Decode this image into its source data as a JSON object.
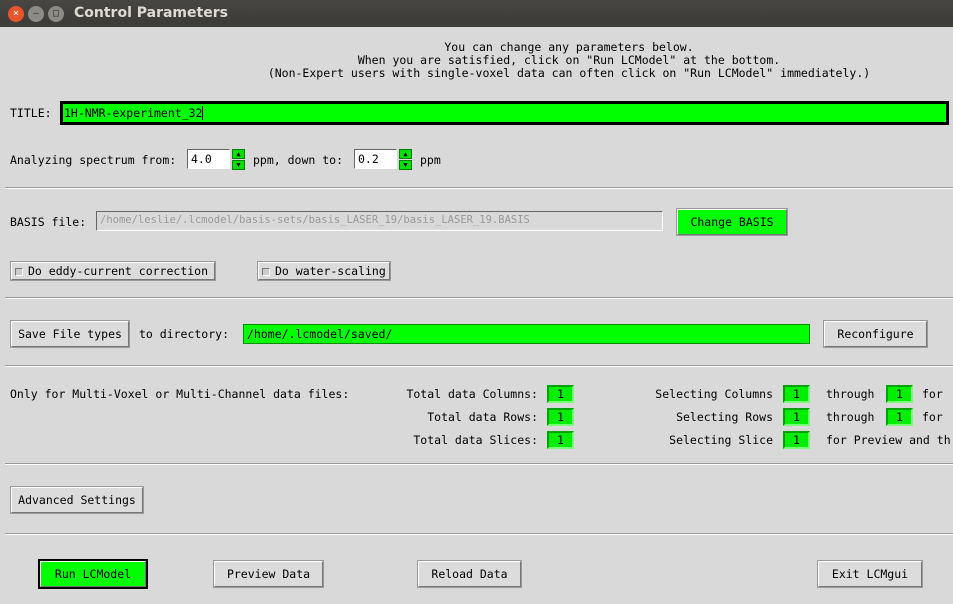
{
  "window": {
    "title": "Control Parameters",
    "close": "×",
    "minimize": "–",
    "maximize": "□"
  },
  "intro": [
    "You can change any parameters below.",
    "When you are satisfied, click on \"Run LCModel\" at the bottom.",
    "(Non-Expert users with single-voxel data can often click on \"Run LCModel\" immediately.)"
  ],
  "title_label": "TITLE:",
  "title_value": "1H-NMR-experiment_32",
  "range": {
    "label_from": "Analyzing spectrum from:",
    "from": "4.0",
    "unit1": "ppm, down to:",
    "to": "0.2",
    "unit2": "ppm",
    "up": "▲",
    "down": "▼"
  },
  "basis": {
    "label": "BASIS file:",
    "path": "/home/leslie/.lcmodel/basis-sets/basis_LASER_19/basis_LASER_19.BASIS",
    "change": "Change BASIS"
  },
  "options": {
    "eddy": "Do eddy-current correction",
    "water": "Do water-scaling"
  },
  "save": {
    "button": "Save File types",
    "label": "to directory:",
    "dir": "/home/.lcmodel/saved/",
    "reconfigure": "Reconfigure"
  },
  "multi": {
    "label": "Only for Multi-Voxel or Multi-Channel data files:",
    "total_columns_label": "Total data Columns:",
    "total_columns": "1",
    "total_rows_label": "Total data Rows:",
    "total_rows": "1",
    "total_slices_label": "Total data Slices:",
    "total_slices": "1",
    "sel_columns_label": "Selecting Columns",
    "sel_columns_from": "1",
    "sel_columns_to": "1",
    "sel_rows_label": "Selecting Rows",
    "sel_rows_from": "1",
    "sel_rows_to": "1",
    "sel_slice_label": "Selecting Slice",
    "sel_slice": "1",
    "through": "through",
    "for": "for",
    "for_preview": "for Preview and th"
  },
  "advanced": "Advanced Settings",
  "footer": {
    "run": "Run LCModel",
    "preview": "Preview Data",
    "reload": "Reload Data",
    "exit": "Exit LCMgui"
  }
}
